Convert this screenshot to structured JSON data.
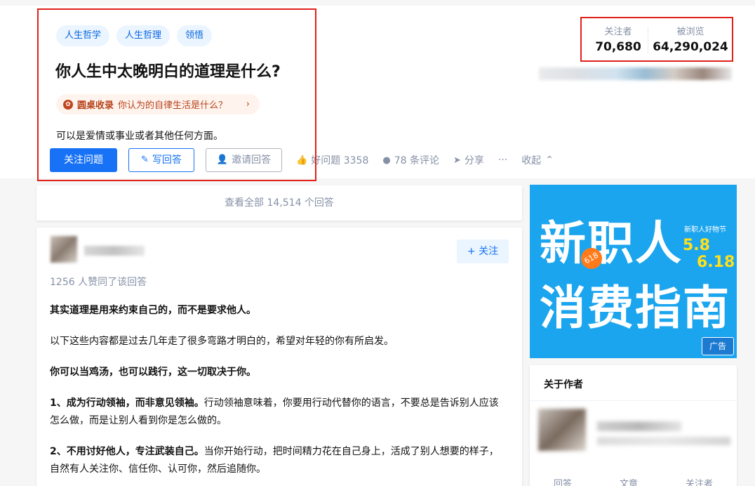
{
  "question": {
    "topics": [
      "人生哲学",
      "人生哲理",
      "领悟"
    ],
    "title": "你人生中太晚明白的道理是什么?",
    "roundtable_label": "圆桌收录",
    "roundtable_question": "你认为的自律生活是什么？",
    "detail": "可以是爱情或事业或者其他任何方面。"
  },
  "actions": {
    "follow_question": "关注问题",
    "write_answer": "写回答",
    "invite_answer": "邀请回答",
    "good_question": "好问题 3358",
    "comments": "78 条评论",
    "share": "分享",
    "more": "···",
    "collapse": "收起"
  },
  "stats": {
    "followers_label": "关注者",
    "followers_value": "70,680",
    "views_label": "被浏览",
    "views_value": "64,290,024"
  },
  "answers": {
    "view_all": "查看全部 14,514 个回答"
  },
  "answer": {
    "follow_label": "关注",
    "upvotes": "1256 人赞同了该回答",
    "p1": "其实道理是用来约束自己的，而不是要求他人。",
    "p2": "以下这些内容都是过去几年走了很多弯路才明白的，希望对年轻的你有所启发。",
    "p3": "你可以当鸡汤，也可以践行，这一切取决于你。",
    "p4_bold": "1、成为行动领袖，而非意见领袖。",
    "p4_rest": "行动领袖意味着，你要用行动代替你的语言，不要总是告诉别人应该怎么做，而是让别人看到你是怎么做的。",
    "p5_bold": "2、不用讨好他人，专注武装自己。",
    "p5_rest": "当你开始行动，把时间精力花在自己身上，活成了别人想要的样子，自然有人关注你、信任你、认可你，然后追随你。"
  },
  "ad": {
    "line1": "新职人",
    "line2": "消费指南",
    "tag": "新职人好物节",
    "date1": "5.8",
    "date2": "6.18",
    "badge": "618",
    "label": "广告"
  },
  "author_card": {
    "title": "关于作者",
    "stat1": "回答",
    "stat2": "文章",
    "stat3": "关注者"
  },
  "colors": {
    "brand_blue": "#1772f6",
    "highlight_red": "#e0201b",
    "ad_blue": "#1ba5ee"
  }
}
